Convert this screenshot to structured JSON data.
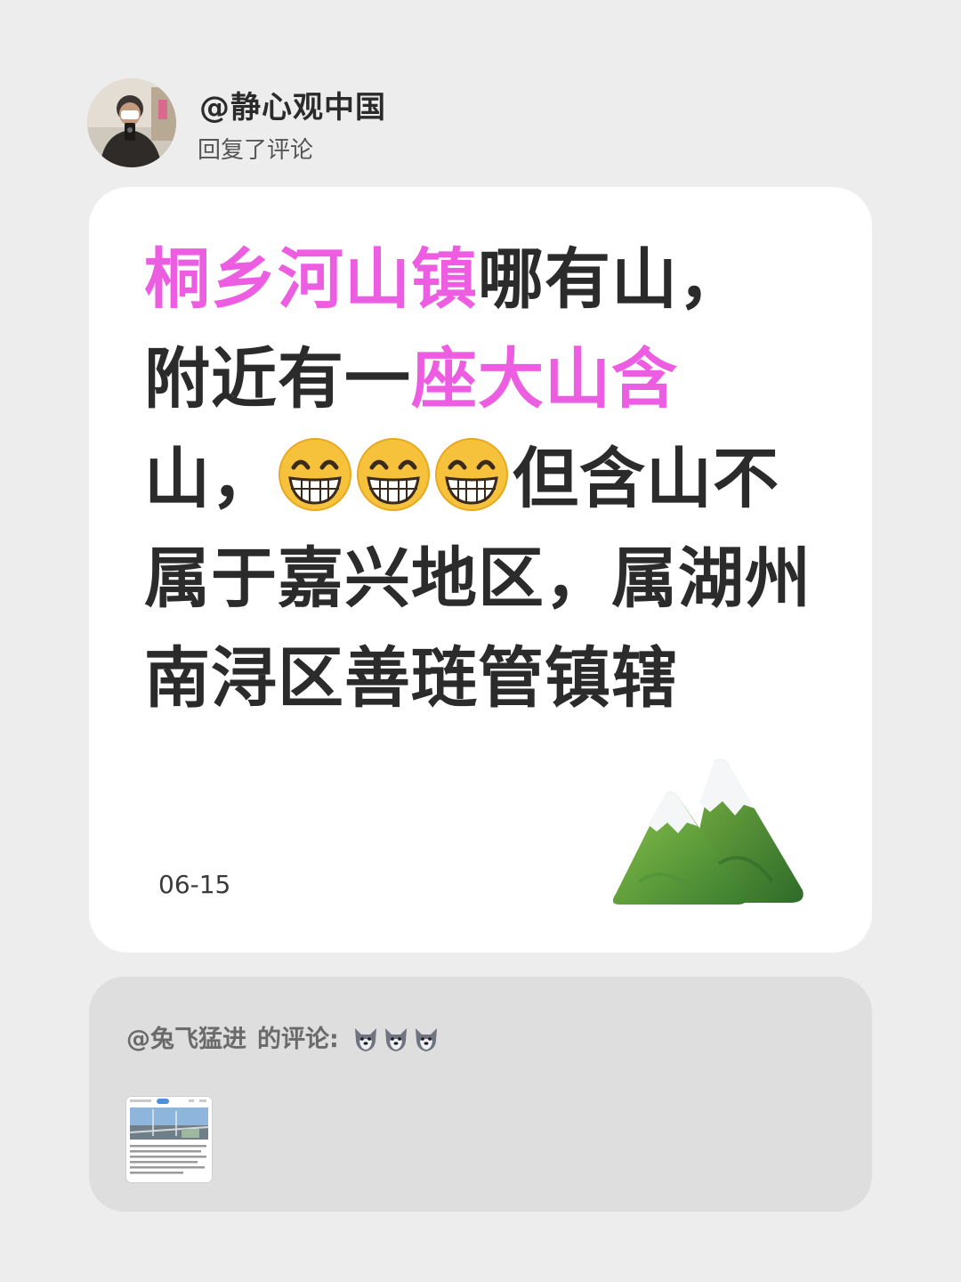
{
  "header": {
    "username": "@静心观中国",
    "subtitle": "回复了评论",
    "avatar_icon": "user-avatar-photo"
  },
  "reply": {
    "segments": [
      {
        "text": "桐乡河山镇",
        "highlight": true
      },
      {
        "text": "哪有山，",
        "highlight": false
      },
      {
        "text": "附近有一",
        "highlight": false
      },
      {
        "text": "座大山含",
        "highlight": true
      },
      {
        "text": "山，",
        "highlight": false
      },
      {
        "text": "但含山不属于嘉兴地区，属湖州南浔区善琏管镇辖",
        "highlight": false
      }
    ],
    "emoji": "grinning-face-with-smiling-eyes",
    "emoji_count": 3,
    "date": "06-15",
    "decoration_icon": "snow-capped-mountain-icon"
  },
  "quote": {
    "author": "@兔飞猛进",
    "label": "的评论:",
    "emoji": "wolf-face",
    "emoji_count": 3,
    "thumbnail_icon": "screenshot-thumbnail"
  },
  "colors": {
    "background": "#ededed",
    "card": "#ffffff",
    "highlight": "#ec5de2",
    "text": "#2b2b2b",
    "quote_background": "#dedede"
  }
}
